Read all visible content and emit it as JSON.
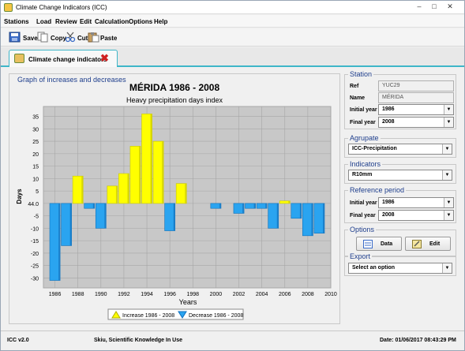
{
  "window": {
    "title": "Climate Change Indicators (ICC)",
    "controls": {
      "minimize": "–",
      "maximize": "□",
      "close": "✕"
    }
  },
  "menu": {
    "items": [
      "Stations",
      "Load",
      "Review",
      "Edit",
      "Calculation",
      "Options",
      "Help"
    ]
  },
  "toolbar": {
    "save_label": "Save",
    "copy_label": "Copy",
    "cut_label": "Cut",
    "paste_label": "Paste"
  },
  "tab": {
    "label": "Climate change indicators",
    "close_icon": "close-icon",
    "color": "#3fb6c8"
  },
  "graph_panel": {
    "title": "Graph of increases and decreases"
  },
  "chart_data": {
    "type": "bar",
    "title": "MÉRIDA 1986 - 2008",
    "subtitle": "Heavy precipitation days index",
    "xlabel": "Years",
    "ylabel": "Days",
    "baseline_label": "44.0",
    "baseline": 44.0,
    "xlim": [
      1985,
      2010
    ],
    "ylim": [
      -34,
      39
    ],
    "x_ticks": [
      "1986",
      "1988",
      "1990",
      "1992",
      "1994",
      "1996",
      "1998",
      "2000",
      "2002",
      "2004",
      "2006",
      "2008",
      "2010"
    ],
    "y_ticks": [
      "35",
      "30",
      "25",
      "20",
      "15",
      "10",
      "5",
      "44.0",
      "-5",
      "-10",
      "-15",
      "-20",
      "-25",
      "-30"
    ],
    "grid": true,
    "background": "#c8c8c8",
    "x": [
      1986,
      1987,
      1988,
      1989,
      1990,
      1991,
      1992,
      1993,
      1994,
      1995,
      1996,
      1997,
      1998,
      1999,
      2000,
      2001,
      2002,
      2003,
      2004,
      2005,
      2006,
      2007,
      2008,
      2009
    ],
    "deviation_from_baseline": [
      -31,
      -17,
      11,
      -2,
      -10,
      7,
      12,
      23,
      36,
      25,
      -11,
      8,
      0,
      0,
      -2,
      0,
      -4,
      -2,
      -2,
      -10,
      1,
      -6,
      -13,
      -12
    ],
    "series": [
      {
        "name": "Increase 1986 - 2008",
        "color": "#ffff00"
      },
      {
        "name": "Decrease 1986 - 2008",
        "color": "#2aa4f0"
      }
    ],
    "legend_placement": "bottom"
  },
  "station": {
    "title": "Station",
    "ref_label": "Ref",
    "ref_value": "YUC29",
    "name_label": "Name",
    "name_value": "MÉRIDA",
    "initial_year_label": "Initial year",
    "initial_year_value": "1986",
    "final_year_label": "Final year",
    "final_year_value": "2008"
  },
  "agrupate": {
    "title": "Agrupate",
    "value": "ICC-Precipitation"
  },
  "indicators": {
    "title": "Indicators",
    "value": "R10mm"
  },
  "reference_period": {
    "title": "Reference period",
    "initial_year_label": "Initial year",
    "initial_year_value": "1986",
    "final_year_label": "Final year",
    "final_year_value": "2008"
  },
  "options": {
    "title": "Options",
    "data_label": "Data",
    "edit_label": "Edit"
  },
  "export": {
    "title": "Export",
    "value": "Select an option"
  },
  "status": {
    "version": "ICC v2.0",
    "tagline": "Skiu, Scientific Knowledge In Use",
    "date": "Date: 01/06/2017   08:43:29 PM"
  }
}
